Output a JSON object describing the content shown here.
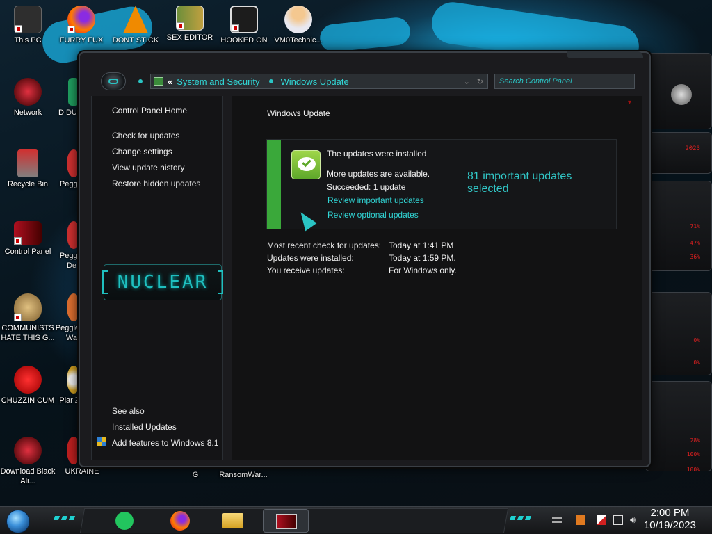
{
  "desktop": {
    "icons": [
      {
        "label": "This PC",
        "icon": "computer-icon",
        "color": "#3a3a3a"
      },
      {
        "label": "FURRY FUX",
        "icon": "firefox-icon",
        "color": "#e66000"
      },
      {
        "label": "DONT STICK",
        "icon": "vlc-icon",
        "color": "#f08a00"
      },
      {
        "label": "SEX EDITOR",
        "icon": "hxd-icon",
        "color": "#c8c8c8"
      },
      {
        "label": "HOOKED ON",
        "icon": "maze-icon",
        "color": "#2a2a2a"
      },
      {
        "label": "VM0Technic...",
        "icon": "doctor-icon",
        "color": "#f0d0b0"
      },
      {
        "label": "Network",
        "icon": "network-icon",
        "color": "#b01020"
      },
      {
        "label": "Recycle Bin",
        "icon": "recycle-bin-icon",
        "color": "#c02020"
      },
      {
        "label": "Control Panel",
        "icon": "control-panel-icon",
        "color": "#b01020"
      },
      {
        "label": "COMMUNISTS HATE THIS G...",
        "icon": "money-bag-icon",
        "color": "#c8a060"
      },
      {
        "label": "CHUZZIN CUM",
        "icon": "chuzzle-icon",
        "color": "#d02020"
      },
      {
        "label": "Download Black Ali...",
        "icon": "alienware-icon",
        "color": "#b01020"
      },
      {
        "label": "D DUM",
        "icon": "app-icon",
        "color": "#20a060"
      },
      {
        "label": "Peggle",
        "icon": "peggle-icon",
        "color": "#d03030"
      },
      {
        "label": "Peggle De",
        "icon": "peggle-icon",
        "color": "#d03030"
      },
      {
        "label": "Peggle of Wa",
        "icon": "peggle-icon",
        "color": "#e07030"
      },
      {
        "label": "Plar Zo",
        "icon": "flower-icon",
        "color": "#f0f0f0"
      },
      {
        "label": "UKRAINE",
        "icon": "app-icon",
        "color": "#c02020"
      },
      {
        "label": "G",
        "icon": "app-icon",
        "color": "#808080"
      },
      {
        "label": "RansomWar...",
        "icon": "app-icon",
        "color": "#404040"
      }
    ]
  },
  "window": {
    "breadcrumb": [
      "System and Security",
      "Windows Update"
    ],
    "breadcrumb_chevron": "«",
    "search_placeholder": "Search Control Panel",
    "sidebar": {
      "home_link": "Control Panel Home",
      "links": [
        "Check for updates",
        "Change settings",
        "View update history",
        "Restore hidden updates"
      ],
      "logo_text": "NUCLEAR",
      "see_also_label": "See also",
      "see_also_links": [
        "Installed Updates",
        "Add features to Windows 8.1"
      ]
    },
    "content": {
      "title": "Windows Update",
      "status_heading": "The updates were installed",
      "more_updates": "More updates are available.",
      "succeeded": "Succeeded: 1 update",
      "review_important": "Review important updates",
      "review_optional": "Review optional updates",
      "selected_count": "81 important updates selected",
      "info": [
        {
          "label": "Most recent check for updates:",
          "value": "Today at 1:41 PM"
        },
        {
          "label": "Updates were installed:",
          "value": "Today at 1:59 PM."
        },
        {
          "label": "You receive updates:",
          "value": "For Windows only."
        }
      ]
    }
  },
  "gadgets": {
    "values": [
      "2023",
      "71%",
      "47%",
      "36%",
      "0%",
      "0%",
      "28%",
      "100%",
      "100%"
    ]
  },
  "taskbar": {
    "time": "2:00 PM",
    "date": "10/19/2023",
    "apps": [
      {
        "icon": "notes-icon",
        "color": "#22c55e"
      },
      {
        "icon": "firefox-icon",
        "color": "#e66000"
      },
      {
        "icon": "file-explorer-icon",
        "color": "#f0c040"
      },
      {
        "icon": "control-panel-icon",
        "color": "#b01020"
      }
    ]
  },
  "colors": {
    "accent": "#31d6d6",
    "status_green": "#3aa83a",
    "window_bg": "#121213",
    "alert_red": "#e02020"
  }
}
